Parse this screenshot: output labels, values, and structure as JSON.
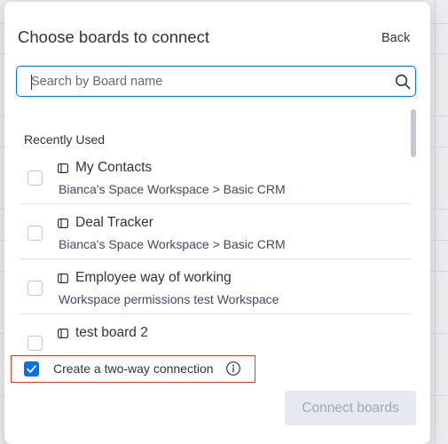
{
  "modal": {
    "title": "Choose boards to connect",
    "back_label": "Back"
  },
  "search": {
    "placeholder": "Search by Board name",
    "value": ""
  },
  "list": {
    "section_label": "Recently Used",
    "items": [
      {
        "name": "My Contacts",
        "workspace": "Bianca's Space Workspace > Basic CRM",
        "checked": false
      },
      {
        "name": "Deal Tracker",
        "workspace": "Bianca's Space Workspace > Basic CRM",
        "checked": false
      },
      {
        "name": "Employee way of working",
        "workspace": "Workspace permissions test Workspace",
        "checked": false
      },
      {
        "name": "test board 2",
        "workspace": "",
        "checked": false
      }
    ]
  },
  "two_way": {
    "label": "Create a two-way connection",
    "checked": true
  },
  "footer": {
    "connect_label": "Connect boards"
  },
  "colors": {
    "accent": "#0073ea",
    "highlight_border": "#d8402f",
    "disabled_button_bg": "#e6e9ef",
    "disabled_button_text": "#a2a7b3"
  },
  "icons": {
    "search": "search-icon",
    "board": "board-icon",
    "info": "info-icon",
    "check": "checkmark-icon"
  }
}
